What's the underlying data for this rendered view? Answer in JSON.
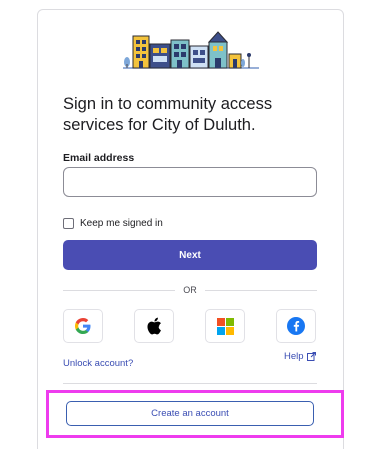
{
  "signin": {
    "title": "Sign in to community access services for City of Duluth.",
    "email_label": "Email address",
    "email_value": "",
    "remember_label": "Keep me signed in",
    "next_label": "Next",
    "divider_label": "OR",
    "unlock_label": "Unlock account?",
    "help_label": "Help",
    "create_label": "Create an account"
  },
  "social_providers": [
    "google",
    "apple",
    "microsoft",
    "facebook"
  ],
  "colors": {
    "primary": "#4a4db3",
    "link": "#3a4db3",
    "highlight": "#ee3cee"
  }
}
